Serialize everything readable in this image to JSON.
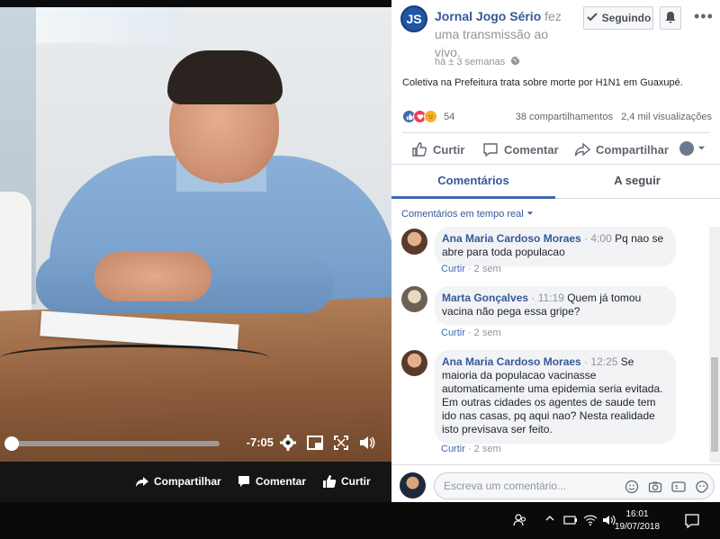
{
  "video": {
    "time_remaining": "-7:05",
    "progress": 0.02,
    "actions": {
      "share": "Compartilhar",
      "comment": "Comentar",
      "like": "Curtir"
    }
  },
  "post": {
    "page_logo": "JS",
    "page_name": "Jornal Jogo Sério",
    "action_text": "fez uma transmissão ao vivo.",
    "time": "há ± 3 semanas",
    "follow_label": "Seguindo",
    "text": "Coletiva na Prefeitura trata sobre morte por H1N1 em Guaxupé.",
    "reaction_count": "54",
    "shares": "38 compartilhamentos",
    "views": "2,4 mil visualizações",
    "actions": {
      "like": "Curtir",
      "comment": "Comentar",
      "share": "Compartilhar"
    }
  },
  "tabs": {
    "comments": "Comentários",
    "up_next": "A seguir"
  },
  "comments_filter": "Comentários em tempo real",
  "comments": [
    {
      "author": "Ana Maria Cardoso Moraes",
      "time": "4:00",
      "text": "Pq nao se abre para toda populacao",
      "reply": "Curtir",
      "age": "2 sem"
    },
    {
      "author": "Marta Gonçalves",
      "time": "11:19",
      "text": "Quem já tomou vacina não pega essa gripe?",
      "reply": "Curtir",
      "age": "2 sem"
    },
    {
      "author": "Ana Maria Cardoso Moraes",
      "time": "12:25",
      "text": "Se maioria da populacao vacinasse automaticamente uma epidemia seria evitada. Em outras cidades os agentes de saude tem ido nas casas, pq aqui nao? Nesta realidade isto previsava ser feito.",
      "reply": "Curtir",
      "age": "2 sem"
    }
  ],
  "compose_placeholder": "Escreva um comentário...",
  "taskbar": {
    "time": "16:01",
    "date": "19/07/2018"
  },
  "colors": {
    "facebook_blue": "#4267b2",
    "link_blue": "#365899"
  }
}
